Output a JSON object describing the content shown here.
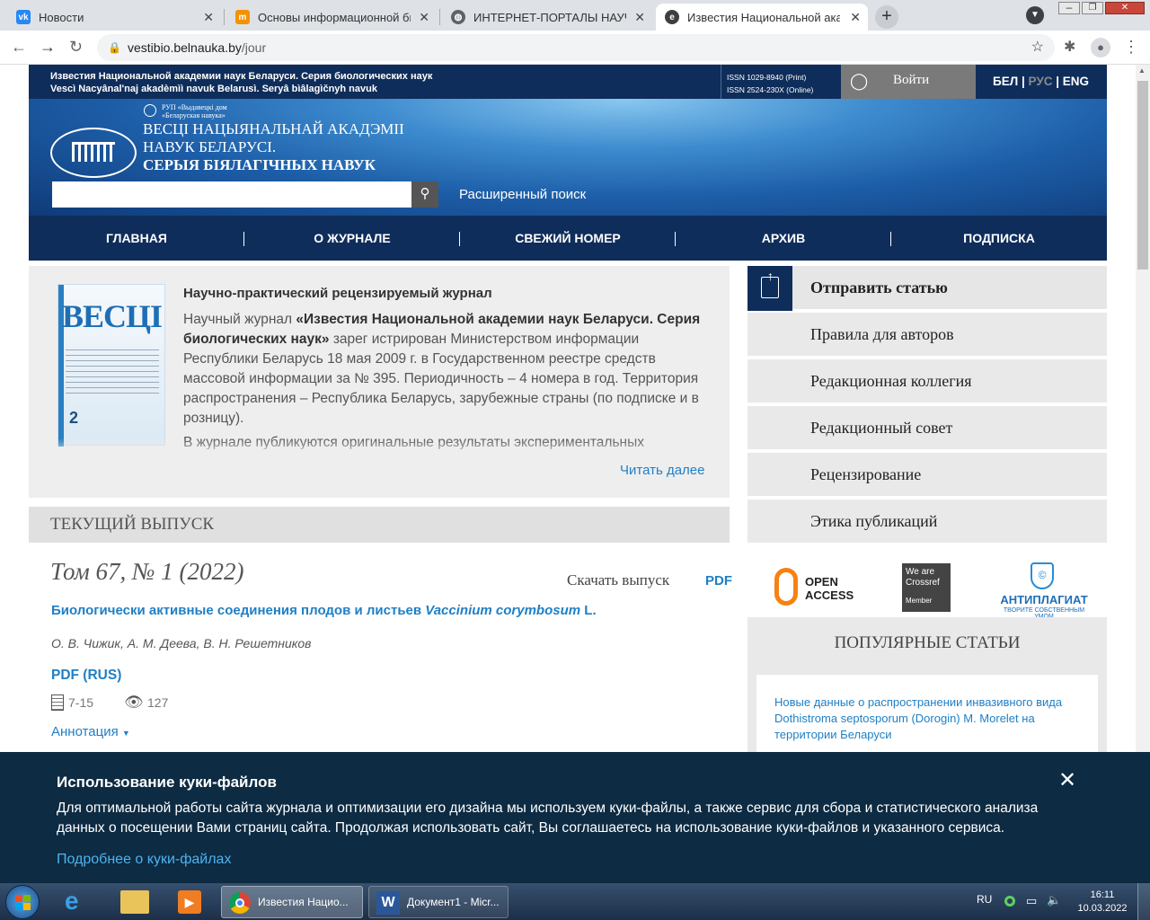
{
  "browser": {
    "tabs": [
      {
        "label": "Новости",
        "favicon": "vk-icon",
        "active": false
      },
      {
        "label": "Основы информационной био",
        "favicon": "m-icon",
        "active": false
      },
      {
        "label": "ИНТЕРНЕТ-ПОРТАЛЫ НАУЧНЫ",
        "favicon": "globe-icon",
        "active": false
      },
      {
        "label": "Известия Национальной акаде",
        "favicon": "e-icon",
        "active": true
      }
    ],
    "url_host": "vestibio.belnauka.by",
    "url_path": "/jour"
  },
  "site": {
    "topbar": {
      "title_ru": "Известия Национальной академии наук Беларуси. Серия биологических наук",
      "title_lat": "Vescì Nacyânal'naj akadèmìì navuk Belarusì. Seryâ bìâlagìčnyh navuk",
      "issn_print": "ISSN 1029-8940 (Print)",
      "issn_online": "ISSN 2524-230X (Online)",
      "login": "Войти",
      "lang_bel": "БЕЛ",
      "lang_sep1": "|",
      "lang_rus": "РУС",
      "lang_sep2": "|",
      "lang_eng": "ENG"
    },
    "hero": {
      "publisher_line1": "РУП «Выдавецкі дом",
      "publisher_line2": "«Беларуская навука»",
      "logo_line1": "ВЕСЦІ НАЦЫЯНАЛЬНАЙ АКАДЭМІІ",
      "logo_line2": "НАВУК БЕЛАРУСІ.",
      "logo_line3": "СЕРЫЯ БІЯЛАГІЧНЫХ НАВУК",
      "search_placeholder": "",
      "advanced_search": "Расширенный поиск"
    },
    "nav": [
      "ГЛАВНАЯ",
      "О ЖУРНАЛЕ",
      "СВЕЖИЙ НОМЕР",
      "АРХИВ",
      "ПОДПИСКА"
    ],
    "about": {
      "cover_title": "ВЕСЦІ",
      "cover_number": "2",
      "heading": "Научно-практический рецензируемый журнал",
      "p1_prefix": "Научный журнал ",
      "p1_bold": "«Известия Национальной  академии наук Беларуси. Серия биологических наук»",
      "p1_rest": " зарег истрирован Министерством информации Республики Беларусь 18 мая 2009 г. в Государственном реестре средств массовой информации за № 395. Периодичность – 4 номера в год. Территория распространения – Республика Беларусь, зарубежные страны (по подписке и в розницу).",
      "p2": "В журнале публикуются оригинальные результаты экспериментальных",
      "read_more": "Читать далее"
    },
    "current": {
      "header": "ТЕКУЩИЙ ВЫПУСК",
      "volume": "Том 67, № 1 (2022)",
      "download": "Скачать выпуск",
      "download_pdf": "PDF",
      "article_title_main": "Биологически активные соединения плодов и листьев ",
      "article_title_italic": "Vaccinium corymbosum",
      "article_title_end": " L.",
      "authors": "О. В. Чижик, А. М. Деева, В. Н. Решетников",
      "pdf": "PDF (RUS)",
      "pages": "7-15",
      "views": "127",
      "annotation": "Аннотация"
    },
    "sidebar": {
      "items": [
        "Отправить статью",
        "Правила для авторов",
        "Редакционная коллегия",
        "Редакционный совет",
        "Рецензирование",
        "Этика публикаций"
      ],
      "oa_line1": "OPEN",
      "oa_line2": "ACCESS",
      "crossref_line1": "We are",
      "crossref_line2": "Crossref",
      "crossref_line3": "Member",
      "antiplagiat": "АНТИПЛАГИАТ",
      "antiplagiat_sub": "ТВОРИТЕ СОБСТВЕННЫМ УМОМ",
      "popular_header": "ПОПУЛЯРНЫЕ СТАТЬИ",
      "popular_article": "Новые данные о распространении инвазивного вида Dothistroma septosporum (Dorogin) M. Morelet на территории Беларуси"
    }
  },
  "cookie": {
    "title": "Использование куки-файлов",
    "text": "Для оптимальной работы сайта журнала и оптимизации его дизайна мы используем куки-файлы, а также сервис для сбора и статистического анализа данных о посещении Вами страниц сайта. Продолжая использовать сайт, Вы соглашаетесь на использование куки-файлов и указанного сервиса.",
    "link": "Подробнее о куки-файлах"
  },
  "taskbar": {
    "chrome_label": "Известия Нацио...",
    "word_label": "Документ1 - Micr...",
    "lang": "RU",
    "time": "16:11",
    "date": "10.03.2022"
  }
}
